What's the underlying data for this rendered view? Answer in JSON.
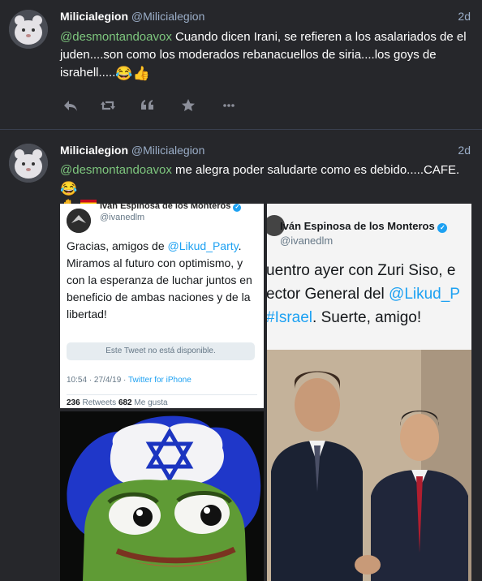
{
  "statuses": [
    {
      "display_name": "Milicialegion",
      "handle": "@Milicialegion",
      "time": "2d",
      "mention": "@desmontandoavox",
      "text": " Cuando dicen Irani, se refieren a los asalariados de el juden....son como los moderados rebanacuellos de siria....los goys de israhell.....",
      "emojis": [
        "😂",
        "👍"
      ]
    },
    {
      "display_name": "Milicialegion",
      "handle": "@Milicialegion",
      "time": "2d",
      "mention": "@desmontandoavox",
      "text": " me alegra poder saludarte como es debido.....CAFE.",
      "emojis": [
        "😂",
        "✋",
        "🇪🇸"
      ]
    }
  ],
  "tweet_card": {
    "author": "Iván Espinosa de los Monteros",
    "handle": "@ivanedlm",
    "text_before": "Gracias, amigos de ",
    "mention": "@Likud_Party",
    "text_after": ". Miramos al futuro con optimismo, y con la esperanza de luchar juntos en beneficio de ambas naciones y de la libertad!",
    "unavailable": "Este Tweet no está disponible.",
    "timestamp": "10:54 · 27/4/19 · ",
    "client": "Twitter for iPhone",
    "retweets": "236",
    "retweets_label": "Retweets",
    "likes": "682",
    "likes_label": "Me gusta"
  },
  "photo_card": {
    "author": "Iván Espinosa de los Monteros",
    "handle": "@ivanedlm",
    "line1": "uentro ayer con Zuri Siso, e",
    "line2_prefix": "ector General del ",
    "line2_mention": "@Likud_P",
    "hashtag": "#Israel",
    "line3_rest": ". Suerte, amigo!"
  },
  "colors": {
    "background": "#26272b",
    "mention": "#7ec77e",
    "muted": "#9baec8",
    "twitter_link": "#1da1f2"
  }
}
